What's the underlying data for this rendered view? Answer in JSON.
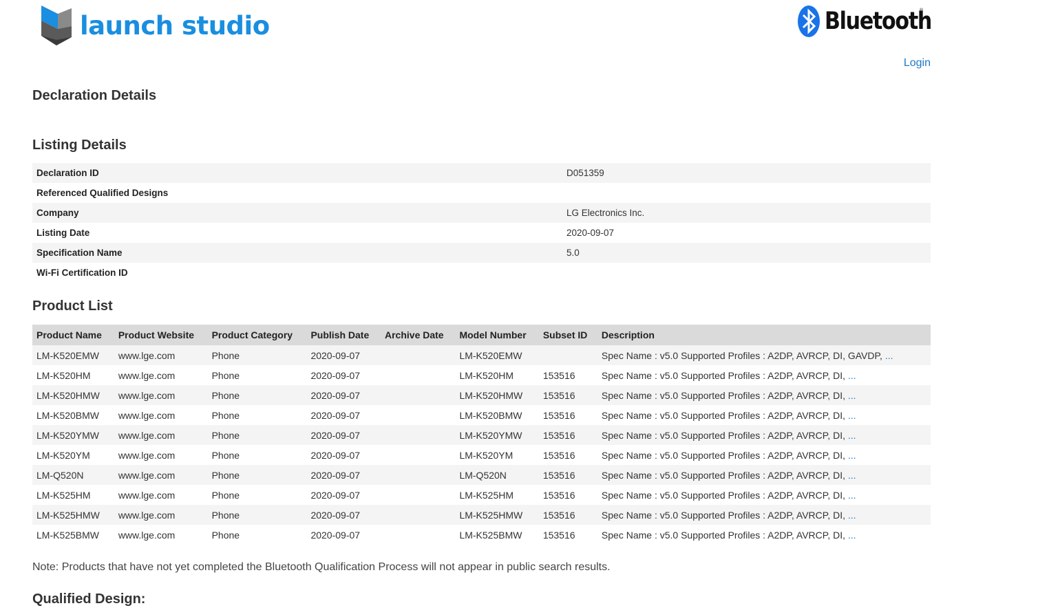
{
  "brand": {
    "launch_name": "launch studio",
    "launch_color": "#1a8ee0",
    "launch_logo_icon": "launch-studio-cube-icon",
    "bt_name": "Bluetooth",
    "bt_reg": "®",
    "bt_color": "#1a73e8",
    "bt_logo_icon": "bluetooth-rune-icon"
  },
  "nav": {
    "login": "Login"
  },
  "page": {
    "declaration_title": "Declaration Details",
    "listing_title": "Listing Details",
    "product_title": "Product List",
    "qualified_title": "Qualified Design:",
    "note": "Note: Products that have not yet completed the Bluetooth Qualification Process will not appear in public search results."
  },
  "listing": [
    {
      "key": "Declaration ID",
      "value": "D051359"
    },
    {
      "key": "Referenced Qualified Designs",
      "value": ""
    },
    {
      "key": "Company",
      "value": "LG Electronics Inc."
    },
    {
      "key": "Listing Date",
      "value": "2020-09-07"
    },
    {
      "key": "Specification Name",
      "value": "5.0"
    },
    {
      "key": "Wi-Fi Certification ID",
      "value": ""
    }
  ],
  "products": {
    "headers": [
      "Product Name",
      "Product Website",
      "Product Category",
      "Publish Date",
      "Archive Date",
      "Model Number",
      "Subset ID",
      "Description"
    ],
    "ellipsis": "...",
    "rows": [
      {
        "name": "LM-K520EMW",
        "website": "www.lge.com",
        "category": "Phone",
        "publish": "2020-09-07",
        "archive": "",
        "model": "LM-K520EMW",
        "subset": "",
        "desc": "Spec Name : v5.0 Supported Profiles : A2DP, AVRCP, DI, GAVDP,"
      },
      {
        "name": "LM-K520HM",
        "website": "www.lge.com",
        "category": "Phone",
        "publish": "2020-09-07",
        "archive": "",
        "model": "LM-K520HM",
        "subset": "153516",
        "desc": "Spec Name : v5.0 Supported Profiles : A2DP, AVRCP, DI,"
      },
      {
        "name": "LM-K520HMW",
        "website": "www.lge.com",
        "category": "Phone",
        "publish": "2020-09-07",
        "archive": "",
        "model": "LM-K520HMW",
        "subset": "153516",
        "desc": "Spec Name : v5.0 Supported Profiles : A2DP, AVRCP, DI,"
      },
      {
        "name": "LM-K520BMW",
        "website": "www.lge.com",
        "category": "Phone",
        "publish": "2020-09-07",
        "archive": "",
        "model": "LM-K520BMW",
        "subset": "153516",
        "desc": "Spec Name : v5.0 Supported Profiles : A2DP, AVRCP, DI,"
      },
      {
        "name": "LM-K520YMW",
        "website": "www.lge.com",
        "category": "Phone",
        "publish": "2020-09-07",
        "archive": "",
        "model": "LM-K520YMW",
        "subset": "153516",
        "desc": "Spec Name : v5.0 Supported Profiles : A2DP, AVRCP, DI,"
      },
      {
        "name": "LM-K520YM",
        "website": "www.lge.com",
        "category": "Phone",
        "publish": "2020-09-07",
        "archive": "",
        "model": "LM-K520YM",
        "subset": "153516",
        "desc": "Spec Name : v5.0 Supported Profiles : A2DP, AVRCP, DI,"
      },
      {
        "name": "LM-Q520N",
        "website": "www.lge.com",
        "category": "Phone",
        "publish": "2020-09-07",
        "archive": "",
        "model": "LM-Q520N",
        "subset": "153516",
        "desc": "Spec Name : v5.0 Supported Profiles : A2DP, AVRCP, DI,"
      },
      {
        "name": "LM-K525HM",
        "website": "www.lge.com",
        "category": "Phone",
        "publish": "2020-09-07",
        "archive": "",
        "model": "LM-K525HM",
        "subset": "153516",
        "desc": "Spec Name : v5.0 Supported Profiles : A2DP, AVRCP, DI,"
      },
      {
        "name": "LM-K525HMW",
        "website": "www.lge.com",
        "category": "Phone",
        "publish": "2020-09-07",
        "archive": "",
        "model": "LM-K525HMW",
        "subset": "153516",
        "desc": "Spec Name : v5.0 Supported Profiles : A2DP, AVRCP, DI,"
      },
      {
        "name": "LM-K525BMW",
        "website": "www.lge.com",
        "category": "Phone",
        "publish": "2020-09-07",
        "archive": "",
        "model": "LM-K525BMW",
        "subset": "153516",
        "desc": "Spec Name : v5.0 Supported Profiles : A2DP, AVRCP, DI,"
      }
    ]
  }
}
